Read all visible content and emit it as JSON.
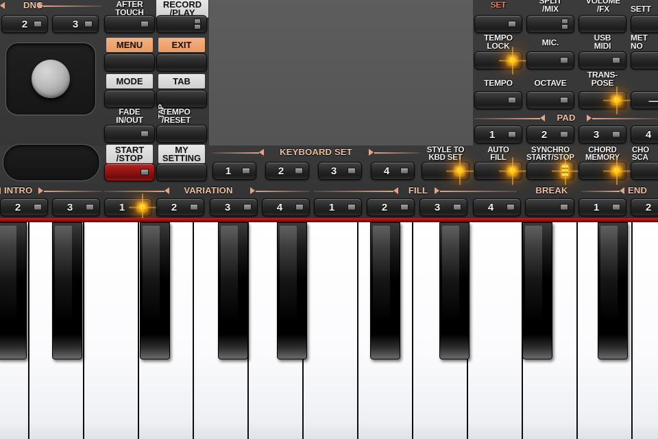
{
  "device": {
    "type": "arranger-keyboard-control-panel",
    "display_area": "blank"
  },
  "colors": {
    "panel": "#363636",
    "display": "#585858",
    "rail_text": "#f0bfa2",
    "led_on": "#ffd21e",
    "start_stop_red": "#a81f1f",
    "felt_red": "#c01a1a",
    "plate_orange": "#efa873"
  },
  "top_left": {
    "dnc_rail": "DNC",
    "dnc_buttons": [
      {
        "label": "2",
        "led": "off"
      },
      {
        "label": "3",
        "led": "off"
      }
    ],
    "after_touch": {
      "label": "AFTER\nTOUCH",
      "led": "off"
    },
    "record_play": {
      "label": "RECORD\n/PLAY",
      "led": "double-off"
    }
  },
  "function_column": [
    {
      "name": "menu",
      "plate": "MENU",
      "plate_style": "orange",
      "led": "none"
    },
    {
      "name": "exit",
      "plate": "EXIT",
      "plate_style": "orange",
      "led": "none"
    },
    {
      "name": "mode",
      "plate": "MODE",
      "plate_style": "light",
      "led": "none"
    },
    {
      "name": "tab",
      "plate": "TAB",
      "plate_style": "light",
      "led": "none"
    },
    {
      "name": "fade-in-out",
      "plate": "FADE\nIN/OUT",
      "plate_style": "legend",
      "led": "off"
    },
    {
      "name": "tap-tempo-reset",
      "plate": "TEMPO\n/RESET",
      "plate_style": "legend",
      "led": "none",
      "side_label": "TAP"
    },
    {
      "name": "start-stop",
      "plate": "START\n/STOP",
      "plate_style": "light",
      "led": "off",
      "button_color": "red"
    },
    {
      "name": "my-setting",
      "plate": "MY\nSETTING",
      "plate_style": "light",
      "led": "none"
    }
  ],
  "right_panel": {
    "row1": [
      {
        "label": "SET",
        "style": "rail-color",
        "led": "off"
      },
      {
        "label": "SPLIT\n/MIX",
        "led": "double-off"
      },
      {
        "label": "VOLUME\n/FX",
        "led": "none"
      },
      {
        "label": "SETT",
        "truncated": true,
        "led": "none"
      }
    ],
    "row2": [
      {
        "label": "TEMPO\nLOCK",
        "led": "on"
      },
      {
        "label": "MIC.",
        "led": "off"
      },
      {
        "label": "USB\nMIDI",
        "led": "off"
      },
      {
        "label": "MET\nNO",
        "truncated": true,
        "led": "none"
      }
    ],
    "row3": [
      {
        "label": "TEMPO",
        "led": "off"
      },
      {
        "label": "OCTAVE",
        "led": "off"
      },
      {
        "label": "TRANS-\nPOSE",
        "led": "on"
      },
      {
        "label": "",
        "truncated": true,
        "face_text": "—",
        "led": "none"
      }
    ],
    "pad_rail": "PAD",
    "pads": [
      {
        "label": "1",
        "led": "off"
      },
      {
        "label": "2",
        "led": "off"
      },
      {
        "label": "3",
        "led": "off"
      },
      {
        "label": "4",
        "led": "off",
        "truncated": true
      }
    ]
  },
  "keyboard_set": {
    "rail": "KEYBOARD SET",
    "buttons": [
      {
        "label": "1",
        "led": "off"
      },
      {
        "label": "2",
        "led": "off"
      },
      {
        "label": "3",
        "led": "off"
      },
      {
        "label": "4",
        "led": "off"
      }
    ]
  },
  "style_row": [
    {
      "label": "STYLE TO\nKBD SET",
      "led": "on"
    },
    {
      "label": "AUTO\nFILL",
      "led": "on"
    },
    {
      "label": "SYNCHRO\nSTART/STOP",
      "led": "on-bar"
    },
    {
      "label": "CHORD\nMEMORY",
      "led": "on"
    },
    {
      "label": "CHO\nSCA",
      "led": "none",
      "truncated": true
    }
  ],
  "bottom_row": {
    "rails": [
      {
        "label": "INTRO",
        "left_arrow": true,
        "right_arrow": true
      },
      {
        "label": "VARIATION",
        "left_arrow": true,
        "right_arrow": true
      },
      {
        "label": "FILL",
        "left_arrow": true,
        "right_arrow": true
      },
      {
        "label": "BREAK",
        "left_arrow": false,
        "right_arrow": false
      },
      {
        "label": "END",
        "left_arrow": true,
        "right_arrow": false,
        "truncated": true
      }
    ],
    "buttons": [
      {
        "group": "INTRO",
        "label": "2",
        "led": "off"
      },
      {
        "group": "INTRO",
        "label": "3",
        "led": "off"
      },
      {
        "group": "VARIATION",
        "label": "1",
        "led": "on"
      },
      {
        "group": "VARIATION",
        "label": "2",
        "led": "off"
      },
      {
        "group": "VARIATION",
        "label": "3",
        "led": "off"
      },
      {
        "group": "VARIATION",
        "label": "4",
        "led": "off"
      },
      {
        "group": "FILL",
        "label": "1",
        "led": "off"
      },
      {
        "group": "FILL",
        "label": "2",
        "led": "off"
      },
      {
        "group": "FILL",
        "label": "3",
        "led": "off"
      },
      {
        "group": "FILL",
        "label": "4",
        "led": "off"
      },
      {
        "group": "BREAK",
        "label": "",
        "led": "off"
      },
      {
        "group": "ENDING",
        "label": "1",
        "led": "off"
      },
      {
        "group": "ENDING",
        "label": "2",
        "led": "off",
        "truncated": true
      }
    ]
  },
  "keybed": {
    "white_key_count": 12,
    "black_key_count": 9,
    "felt_strip_color": "#c01a1a"
  }
}
